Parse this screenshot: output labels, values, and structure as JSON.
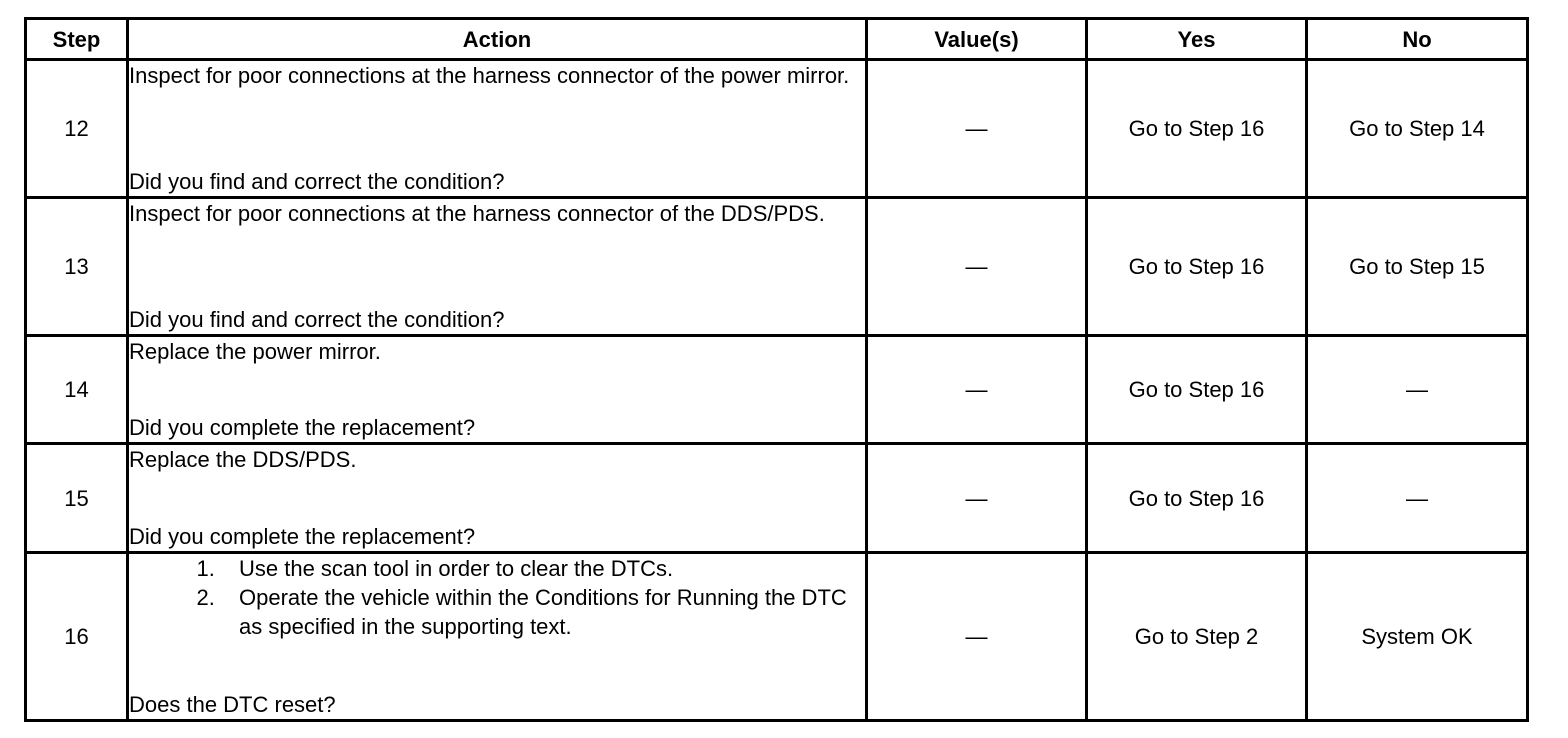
{
  "headers": {
    "step": "Step",
    "action": "Action",
    "values": "Value(s)",
    "yes": "Yes",
    "no": "No"
  },
  "rows": [
    {
      "step": "12",
      "action": "Inspect for poor connections at the harness connector of the power mirror.",
      "question": "Did you find and correct the condition?",
      "value": "—",
      "yes": "Go to Step 16",
      "no": "Go to Step 14"
    },
    {
      "step": "13",
      "action": "Inspect for poor connections at the harness connector of the DDS/PDS.",
      "question": "Did you find and correct the condition?",
      "value": "—",
      "yes": "Go to Step 16",
      "no": "Go to Step 15"
    },
    {
      "step": "14",
      "action": "Replace the power mirror.",
      "question": "Did you complete the replacement?",
      "value": "—",
      "yes": "Go to Step 16",
      "no": "—"
    },
    {
      "step": "15",
      "action": "Replace the DDS/PDS.",
      "question": "Did you complete the replacement?",
      "value": "—",
      "yes": "Go to Step 16",
      "no": "—"
    },
    {
      "step": "16",
      "substeps": [
        "Use the scan tool in order to clear the DTCs.",
        "Operate the vehicle within the Conditions for Running the DTC as specified in the supporting text."
      ],
      "question": "Does the DTC reset?",
      "value": "—",
      "yes": "Go to Step 2",
      "no": "System OK"
    }
  ]
}
